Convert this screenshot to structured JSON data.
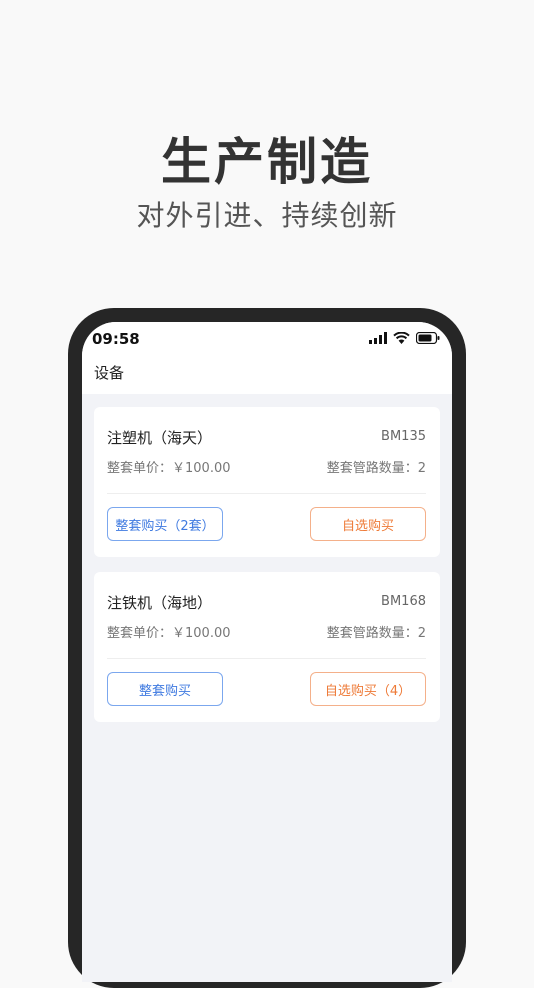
{
  "promo": {
    "title": "生产制造",
    "subtitle": "对外引进、持续创新"
  },
  "status_bar": {
    "time": "09:58"
  },
  "nav": {
    "title": "设备"
  },
  "cards": [
    {
      "name": "注塑机（海天）",
      "code": "BM135",
      "price": "整套单价：￥100.00",
      "lines": "整套管路数量：2",
      "btn_set": "整套购买（2套）",
      "btn_custom": "自选购买"
    },
    {
      "name": "注铁机（海地）",
      "code": "BM168",
      "price": "整套单价：￥100.00",
      "lines": "整套管路数量：2",
      "btn_set": "整套购买",
      "btn_custom": "自选购买（4）"
    }
  ],
  "colors": {
    "accent_blue": "#3f7ae0",
    "accent_orange": "#ee7a37",
    "phone_frame": "#262626",
    "screen_bg": "#f2f3f7"
  },
  "icons": [
    "signal-icon",
    "wifi-icon",
    "battery-icon"
  ]
}
